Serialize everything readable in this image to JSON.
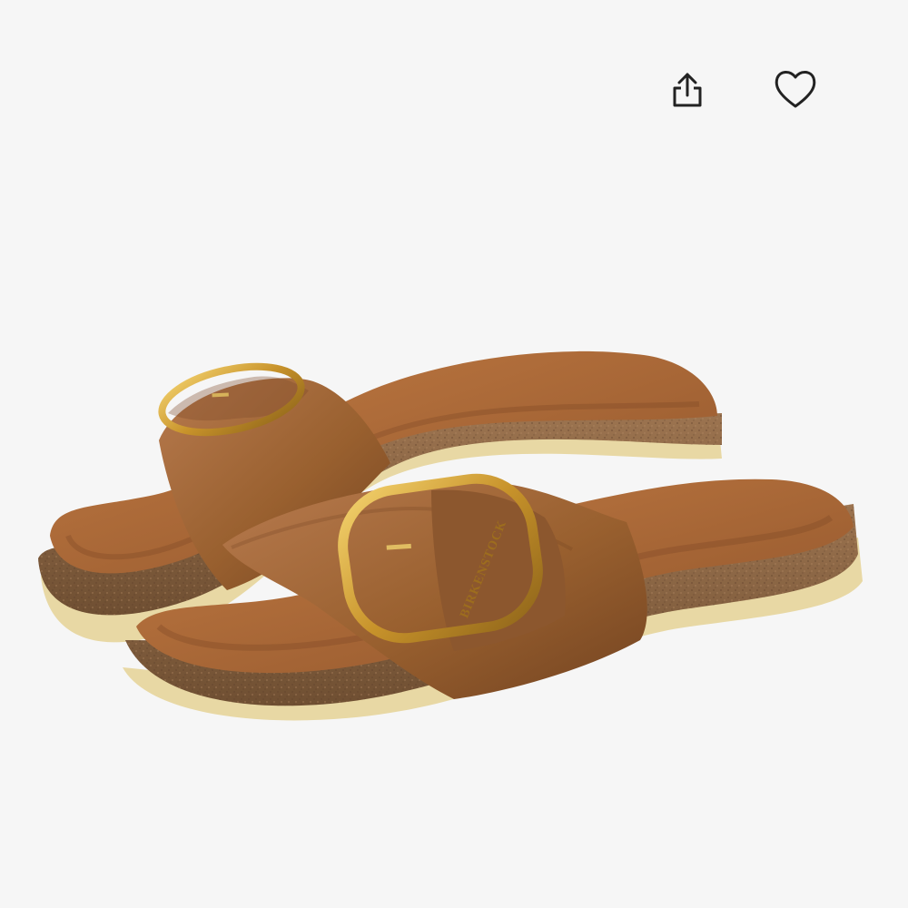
{
  "actions": {
    "share_icon": "share-icon",
    "favorite_icon": "heart-icon"
  },
  "product": {
    "image_brand_text": "BIRKENSTOCK"
  },
  "colors": {
    "background": "#f6f6f6",
    "icon_stroke": "#222222",
    "leather": "#9d6133",
    "footbed": "#ad6b38",
    "cork": "#8b6442",
    "sole": "#e9d9a8",
    "buckle": "#d1a53a"
  }
}
